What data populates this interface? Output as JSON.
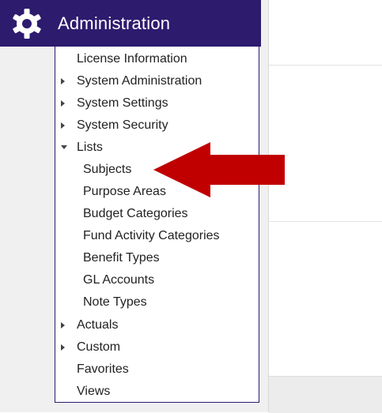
{
  "header": {
    "title": "Administration",
    "icon": "gear-icon",
    "background": "#2d1b6e"
  },
  "menu": {
    "items": [
      {
        "label": "License Information",
        "expandable": false
      },
      {
        "label": "System Administration",
        "expandable": true,
        "expanded": false
      },
      {
        "label": "System Settings",
        "expandable": true,
        "expanded": false
      },
      {
        "label": "System Security",
        "expandable": true,
        "expanded": false
      },
      {
        "label": "Lists",
        "expandable": true,
        "expanded": true
      }
    ],
    "lists_children": [
      {
        "label": "Subjects"
      },
      {
        "label": "Purpose Areas"
      },
      {
        "label": "Budget Categories"
      },
      {
        "label": "Fund Activity Categories"
      },
      {
        "label": "Benefit Types"
      },
      {
        "label": "GL Accounts"
      },
      {
        "label": "Note Types"
      }
    ],
    "after": [
      {
        "label": "Actuals",
        "expandable": true,
        "expanded": false
      },
      {
        "label": "Custom",
        "expandable": true,
        "expanded": false
      },
      {
        "label": "Favorites",
        "expandable": false
      },
      {
        "label": "Views",
        "expandable": false
      }
    ]
  },
  "annotation": {
    "type": "arrow",
    "color": "#c00000",
    "points_to": "Subjects"
  }
}
